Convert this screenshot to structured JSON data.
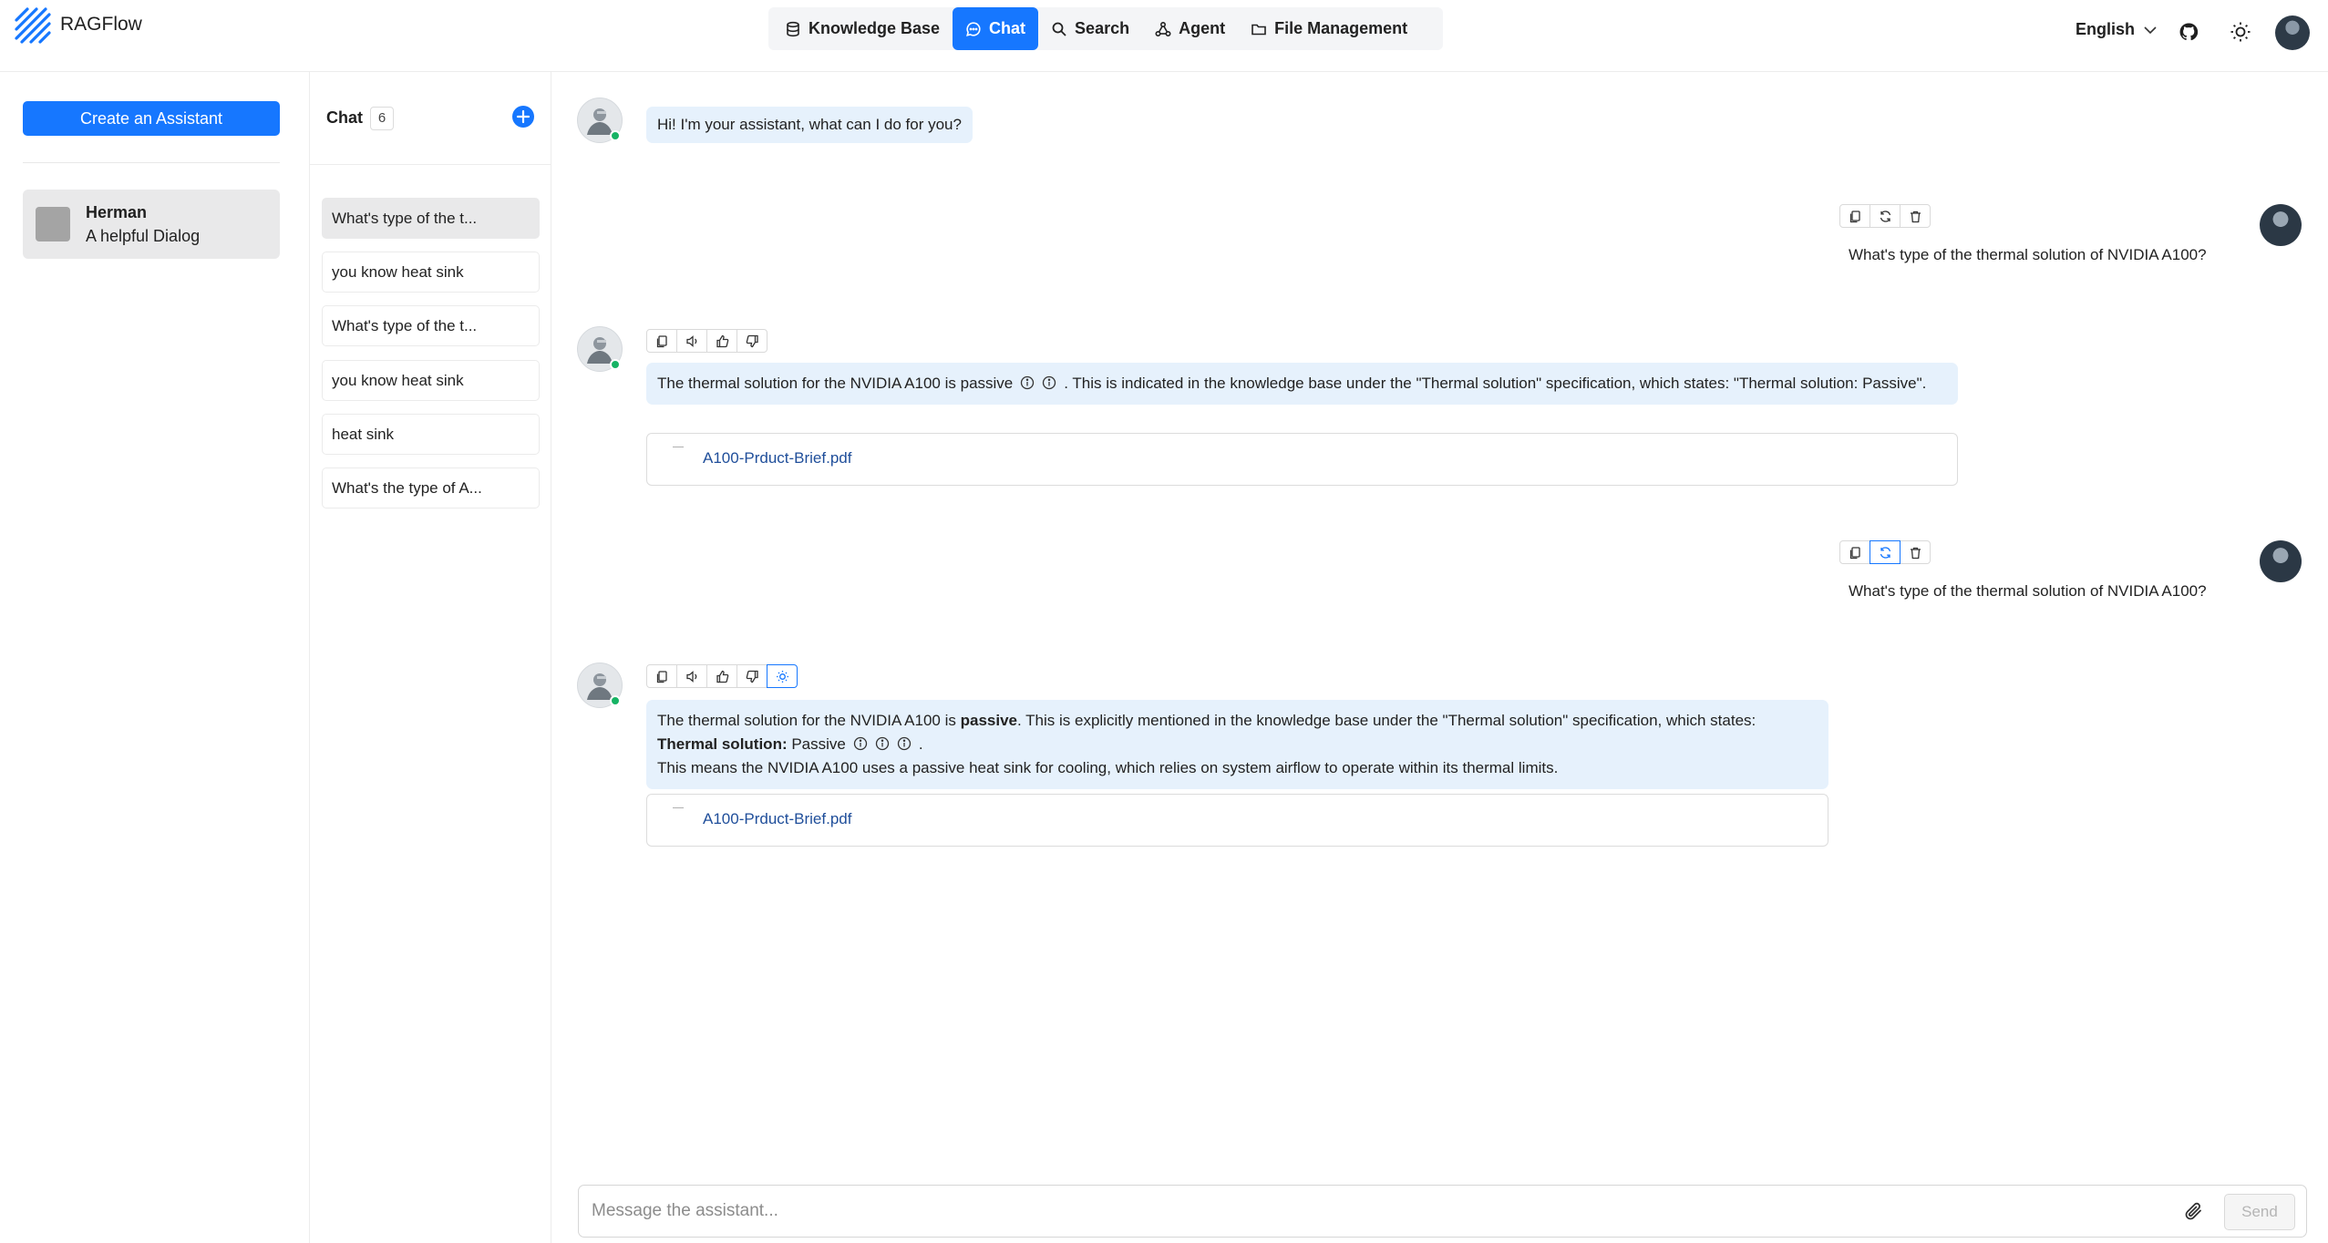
{
  "app": {
    "brand": "RAGFlow"
  },
  "nav": {
    "items": [
      {
        "label": "Knowledge Base",
        "icon": "database-icon",
        "active": false
      },
      {
        "label": "Chat",
        "icon": "chat-bubble-icon",
        "active": true
      },
      {
        "label": "Search",
        "icon": "search-icon",
        "active": false
      },
      {
        "label": "Agent",
        "icon": "agent-graph-icon",
        "active": false
      },
      {
        "label": "File Management",
        "icon": "folder-icon",
        "active": false
      }
    ]
  },
  "header": {
    "language": "English"
  },
  "sidebar": {
    "create_label": "Create an Assistant",
    "assistant": {
      "name": "Herman",
      "description": "A helpful Dialog"
    }
  },
  "chats": {
    "title": "Chat",
    "count": "6",
    "items": [
      {
        "label": "What's type of the t...",
        "active": true
      },
      {
        "label": "you know heat sink",
        "active": false
      },
      {
        "label": "What's type of the t...",
        "active": false
      },
      {
        "label": "you know heat sink",
        "active": false
      },
      {
        "label": "heat sink",
        "active": false
      },
      {
        "label": "What's the type of A...",
        "active": false
      }
    ]
  },
  "messages": {
    "greeting": "Hi! I'm your assistant, what can I do for you?",
    "q1": "What's type of the thermal solution of NVIDIA A100?",
    "a1": {
      "part1": "The thermal solution for the NVIDIA A100 is passive",
      "part2": ". This is indicated in the knowledge base under the \"Thermal solution\" specification, which states: \"Thermal solution: Passive\".",
      "doc": "A100-Prduct-Brief.pdf"
    },
    "q2": "What's type of the thermal solution of NVIDIA A100?",
    "a2": {
      "line1_pre": "The thermal solution for the NVIDIA A100 is ",
      "line1_bold": "passive",
      "line1_post": ". This is explicitly mentioned in the knowledge base under the \"Thermal solution\" specification, which states:",
      "line2_bold": "Thermal solution:",
      "line2_value": " Passive",
      "line2_end": ".",
      "line3": "This means the NVIDIA A100 uses a passive heat sink for cooling, which relies on system airflow to operate within its thermal limits.",
      "doc": "A100-Prduct-Brief.pdf"
    }
  },
  "composer": {
    "placeholder": "Message the assistant...",
    "send_label": "Send"
  },
  "colors": {
    "accent": "#1677ff",
    "bubble": "#e6f1fc",
    "online": "#16b364",
    "link": "#1f4e9a"
  }
}
